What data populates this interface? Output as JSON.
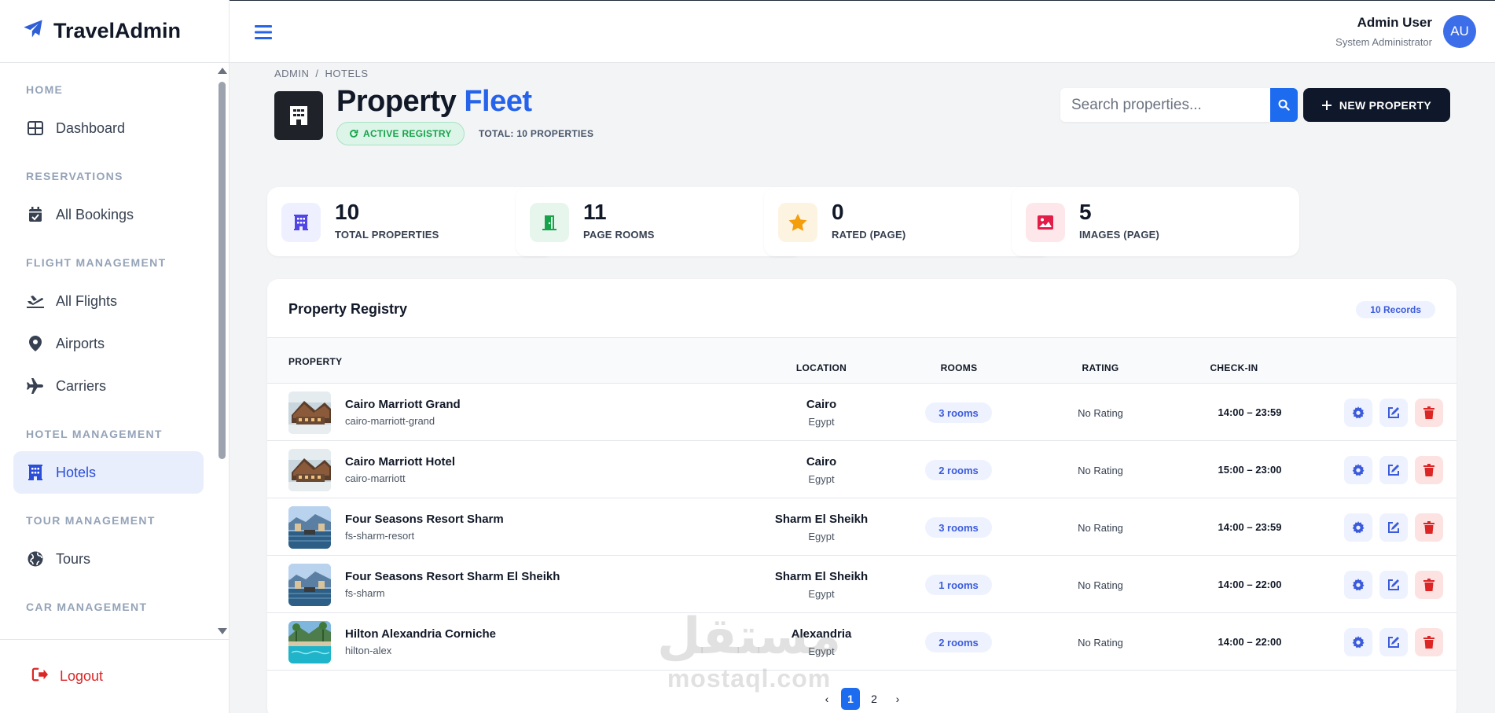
{
  "brand": {
    "name": "TravelAdmin"
  },
  "header": {
    "user_name": "Admin User",
    "user_role": "System Administrator",
    "avatar_initials": "AU"
  },
  "sidebar": {
    "sections": [
      {
        "title": "HOME",
        "items": [
          {
            "label": "Dashboard",
            "icon": "dashboard-icon"
          }
        ]
      },
      {
        "title": "RESERVATIONS",
        "items": [
          {
            "label": "All Bookings",
            "icon": "calendar-check-icon"
          }
        ]
      },
      {
        "title": "FLIGHT MANAGEMENT",
        "items": [
          {
            "label": "All Flights",
            "icon": "plane-departure-icon"
          },
          {
            "label": "Airports",
            "icon": "map-pin-icon"
          },
          {
            "label": "Carriers",
            "icon": "plane-icon"
          }
        ]
      },
      {
        "title": "HOTEL MANAGEMENT",
        "items": [
          {
            "label": "Hotels",
            "icon": "hotel-icon",
            "active": true
          }
        ]
      },
      {
        "title": "TOUR MANAGEMENT",
        "items": [
          {
            "label": "Tours",
            "icon": "globe-icon"
          }
        ]
      },
      {
        "title": "CAR MANAGEMENT",
        "items": []
      }
    ],
    "logout_label": "Logout"
  },
  "breadcrumb": {
    "root": "ADMIN",
    "separator": "/",
    "current": "HOTELS"
  },
  "page": {
    "title_main": "Property",
    "title_accent": "Fleet",
    "status_badge": "ACTIVE REGISTRY",
    "total_text": "TOTAL: 10 PROPERTIES",
    "search_placeholder": "Search properties...",
    "new_button": "NEW PROPERTY"
  },
  "stats": [
    {
      "value": "10",
      "label": "TOTAL PROPERTIES",
      "icon": "hotel-icon",
      "color": "#4f46e5",
      "bg": "#eef0ff"
    },
    {
      "value": "11",
      "label": "PAGE ROOMS",
      "icon": "door-open-icon",
      "color": "#16a34a",
      "bg": "#e6f6ec"
    },
    {
      "value": "0",
      "label": "RATED (PAGE)",
      "icon": "star-icon",
      "color": "#f59e0b",
      "bg": "#fdf3e1"
    },
    {
      "value": "5",
      "label": "IMAGES (PAGE)",
      "icon": "image-icon",
      "color": "#e11d48",
      "bg": "#fde7ea"
    }
  ],
  "registry": {
    "title": "Property Registry",
    "count_badge": "10 Records",
    "columns": {
      "property": "PROPERTY",
      "location": "LOCATION",
      "rooms": "ROOMS",
      "rating": "RATING",
      "checkin": "CHECK-IN"
    },
    "rows": [
      {
        "name": "Cairo Marriott Grand",
        "slug": "cairo-marriott-grand",
        "city": "Cairo",
        "country": "Egypt",
        "rooms": "3 rooms",
        "rating": "No Rating",
        "checkin": "14:00 – 23:59",
        "thumb": "lodge"
      },
      {
        "name": "Cairo Marriott Hotel",
        "slug": "cairo-marriott",
        "city": "Cairo",
        "country": "Egypt",
        "rooms": "2 rooms",
        "rating": "No Rating",
        "checkin": "15:00 – 23:00",
        "thumb": "lodge"
      },
      {
        "name": "Four Seasons Resort Sharm",
        "slug": "fs-sharm-resort",
        "city": "Sharm El Sheikh",
        "country": "Egypt",
        "rooms": "3 rooms",
        "rating": "No Rating",
        "checkin": "14:00 – 23:59",
        "thumb": "lake"
      },
      {
        "name": "Four Seasons Resort Sharm El Sheikh",
        "slug": "fs-sharm",
        "city": "Sharm El Sheikh",
        "country": "Egypt",
        "rooms": "1 rooms",
        "rating": "No Rating",
        "checkin": "14:00 – 22:00",
        "thumb": "lake"
      },
      {
        "name": "Hilton Alexandria Corniche",
        "slug": "hilton-alex",
        "city": "Alexandria",
        "country": "Egypt",
        "rooms": "2 rooms",
        "rating": "No Rating",
        "checkin": "14:00 – 22:00",
        "thumb": "pool"
      }
    ]
  },
  "pagination": {
    "prev": "‹",
    "pages": [
      "1",
      "2"
    ],
    "next": "›",
    "current": "1"
  },
  "watermark": {
    "logo": "مستقل",
    "text": "mostaql.com"
  },
  "colors": {
    "accent": "#2563eb",
    "dark": "#0f172a",
    "danger": "#dc2626",
    "success": "#16a34a"
  }
}
